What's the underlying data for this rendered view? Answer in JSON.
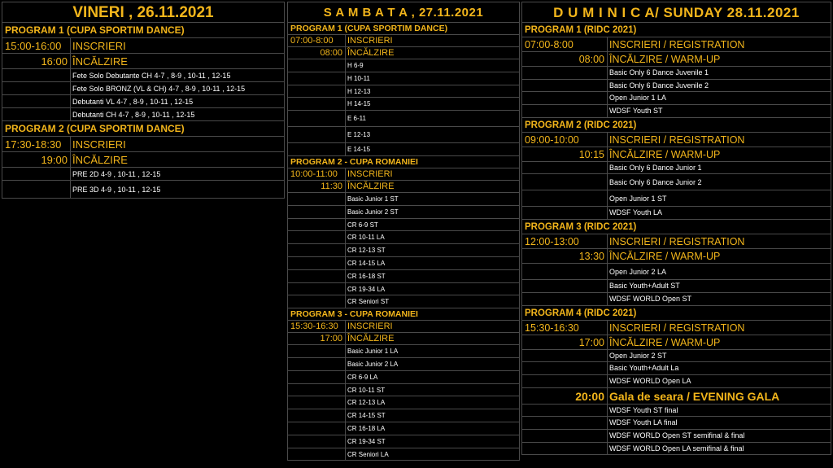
{
  "colors": {
    "accent": "#f2b51b",
    "background": "#000000",
    "grid": "#4a4a4a",
    "text": "#ffffff"
  },
  "friday": {
    "header": "VINERI , 26.11.2021",
    "programs": [
      {
        "title": "PROGRAM 1 (CUPA SPORTIM DANCE)",
        "rows": [
          {
            "time": "15:00-16:00",
            "text": "INSCRIERI",
            "kind": "main"
          },
          {
            "time": "16:00",
            "text": "ÎNCĂLZIRE",
            "kind": "main",
            "right": true
          },
          {
            "time": "",
            "text": "Fete Solo Debutante CH 4-7 , 8-9 , 10-11 , 12-15",
            "kind": "sub"
          },
          {
            "time": "",
            "text": "Fete Solo BRONZ (VL & CH)  4-7 , 8-9 , 10-11 , 12-15",
            "kind": "sub"
          },
          {
            "time": "",
            "text": "Debutanti VL 4-7 , 8-9 , 10-11 , 12-15",
            "kind": "sub"
          },
          {
            "time": "",
            "text": "Debutanti CH 4-7 , 8-9 , 10-11 , 12-15",
            "kind": "sub"
          }
        ]
      },
      {
        "title": "PROGRAM 2 (CUPA SPORTIM DANCE)",
        "rows": [
          {
            "time": "17:30-18:30",
            "text": "INSCRIERI",
            "kind": "main"
          },
          {
            "time": "19:00",
            "text": "ÎNCĂLZIRE",
            "kind": "main",
            "right": true
          },
          {
            "time": "",
            "text": "PRE 2D 4-9 , 10-11 , 12-15",
            "kind": "sub"
          },
          {
            "time": "",
            "text": "PRE 3D 4-9 , 10-11 , 12-15",
            "kind": "sub",
            "tall": true
          }
        ]
      }
    ]
  },
  "saturday": {
    "header": "S A M B A T A , 27.11.2021",
    "programs": [
      {
        "title": "PROGRAM 1 (CUPA SPORTIM DANCE)",
        "rows": [
          {
            "time": "07:00-8:00",
            "text": "INSCRIERI",
            "kind": "main"
          },
          {
            "time": "08:00",
            "text": "ÎNCĂLZIRE",
            "kind": "main",
            "right": true
          },
          {
            "time": "",
            "text": "H 6-9",
            "kind": "sub"
          },
          {
            "time": "",
            "text": "H 10-11",
            "kind": "sub"
          },
          {
            "time": "",
            "text": "H 12-13",
            "kind": "sub"
          },
          {
            "time": "",
            "text": "H 14-15",
            "kind": "sub"
          },
          {
            "time": "",
            "text": "E 6-11",
            "kind": "sub",
            "tall": true
          },
          {
            "time": "",
            "text": "E 12-13",
            "kind": "sub",
            "tall": true
          },
          {
            "time": "",
            "text": "E 14-15",
            "kind": "sub"
          }
        ]
      },
      {
        "title": "PROGRAM 2 - CUPA ROMANIEI",
        "rows": [
          {
            "time": "10:00-11:00",
            "text": "INSCRIERI",
            "kind": "main"
          },
          {
            "time": "11:30",
            "text": "ÎNCĂLZIRE",
            "kind": "main",
            "right": true
          },
          {
            "time": "",
            "text": "Basic Junior 1 ST",
            "kind": "sub"
          },
          {
            "time": "",
            "text": "Basic Junior 2 ST",
            "kind": "sub"
          },
          {
            "time": "",
            "text": "CR 6-9 ST",
            "kind": "sub"
          },
          {
            "time": "",
            "text": "CR 10-11 LA",
            "kind": "sub"
          },
          {
            "time": "",
            "text": "CR 12-13 ST",
            "kind": "sub"
          },
          {
            "time": "",
            "text": "CR 14-15 LA",
            "kind": "sub"
          },
          {
            "time": "",
            "text": "CR 16-18 ST",
            "kind": "sub"
          },
          {
            "time": "",
            "text": "CR 19-34 LA",
            "kind": "sub"
          },
          {
            "time": "",
            "text": "CR Seniori ST",
            "kind": "sub"
          }
        ]
      },
      {
        "title": "PROGRAM  3 - CUPA ROMANIEI",
        "rows": [
          {
            "time": "15:30-16:30",
            "text": "INSCRIERI",
            "kind": "main"
          },
          {
            "time": "17:00",
            "text": "ÎNCĂLZIRE",
            "kind": "main",
            "right": true
          },
          {
            "time": "",
            "text": "Basic Junior 1 LA",
            "kind": "sub"
          },
          {
            "time": "",
            "text": "Basic Junior 2 LA",
            "kind": "sub"
          },
          {
            "time": "",
            "text": "CR 6-9 LA",
            "kind": "sub"
          },
          {
            "time": "",
            "text": "CR 10-11 ST",
            "kind": "sub"
          },
          {
            "time": "",
            "text": "CR 12-13 LA",
            "kind": "sub"
          },
          {
            "time": "",
            "text": "CR 14-15 ST",
            "kind": "sub"
          },
          {
            "time": "",
            "text": "CR 16-18 LA",
            "kind": "sub"
          },
          {
            "time": "",
            "text": "CR 19-34 ST",
            "kind": "sub"
          },
          {
            "time": "",
            "text": "CR Seniori LA",
            "kind": "sub"
          }
        ]
      }
    ]
  },
  "sunday": {
    "header": "D U M I N I C A/ SUNDAY  28.11.2021",
    "programs": [
      {
        "title": "PROGRAM 1 (RIDC 2021)",
        "rows": [
          {
            "time": "07:00-8:00",
            "text": "INSCRIERI / REGISTRATION",
            "kind": "main"
          },
          {
            "time": "08:00",
            "text": "ÎNCĂLZIRE / WARM-UP",
            "kind": "main",
            "right": true
          },
          {
            "time": "",
            "text": "Basic Only 6 Dance Juvenile 1",
            "kind": "sub"
          },
          {
            "time": "",
            "text": "Basic Only 6 Dance Juvenile 2",
            "kind": "sub"
          },
          {
            "time": "",
            "text": "Open Junior 1 LA",
            "kind": "sub"
          },
          {
            "time": "",
            "text": "WDSF Youth ST",
            "kind": "sub"
          }
        ]
      },
      {
        "title": "PROGRAM 2 (RIDC 2021)",
        "rows": [
          {
            "time": "09:00-10:00",
            "text": "INSCRIERI / REGISTRATION",
            "kind": "main"
          },
          {
            "time": "10:15",
            "text": "ÎNCĂLZIRE / WARM-UP",
            "kind": "main",
            "right": true
          },
          {
            "time": "",
            "text": "Basic Only 6 Dance Junior 1",
            "kind": "sub"
          },
          {
            "time": "",
            "text": "Basic Only 6 Dance Junior 2",
            "kind": "sub",
            "tall": true
          },
          {
            "time": "",
            "text": "Open Junior 1 ST",
            "kind": "sub",
            "tall": true
          },
          {
            "time": "",
            "text": "WDSF Youth LA",
            "kind": "sub"
          }
        ]
      },
      {
        "title": "PROGRAM 3 (RIDC 2021)",
        "rows": [
          {
            "time": "12:00-13:00",
            "text": "INSCRIERI / REGISTRATION",
            "kind": "main"
          },
          {
            "time": "13:30",
            "text": "ÎNCĂLZIRE / WARM-UP",
            "kind": "main",
            "right": true
          },
          {
            "time": "",
            "text": "Open Junior 2 LA",
            "kind": "sub",
            "tall": true
          },
          {
            "time": "",
            "text": "Basic Youth+Adult ST",
            "kind": "sub"
          },
          {
            "time": "",
            "text": "WDSF WORLD Open ST",
            "kind": "sub"
          }
        ]
      },
      {
        "title": "PROGRAM 4 (RIDC 2021)",
        "rows": [
          {
            "time": "15:30-16:30",
            "text": "INSCRIERI / REGISTRATION",
            "kind": "main"
          },
          {
            "time": "17:00",
            "text": "ÎNCĂLZIRE / WARM-UP",
            "kind": "main",
            "right": true
          },
          {
            "time": "",
            "text": "Open Junior 2 ST",
            "kind": "sub"
          },
          {
            "time": "",
            "text": "Basic Youth+Adult La",
            "kind": "sub"
          },
          {
            "time": "",
            "text": "WDSF WORLD Open LA",
            "kind": "sub"
          },
          {
            "time": "20:00",
            "text": "Gala de seara / EVENING GALA",
            "kind": "gala",
            "right": true
          },
          {
            "time": "",
            "text": "WDSF Youth ST final",
            "kind": "sub"
          },
          {
            "time": "",
            "text": "WDSF Youth LA final",
            "kind": "sub"
          },
          {
            "time": "",
            "text": "WDSF WORLD Open ST semifinal & final",
            "kind": "sub"
          },
          {
            "time": "",
            "text": "WDSF WORLD Open LA semifinal & final",
            "kind": "sub"
          }
        ]
      }
    ]
  }
}
